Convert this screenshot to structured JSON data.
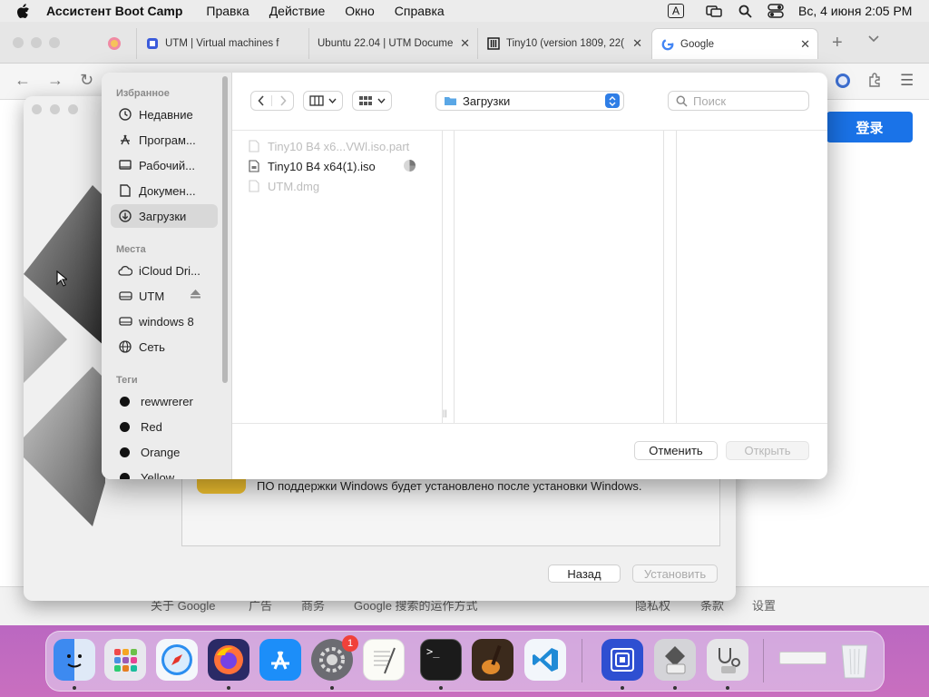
{
  "menubar": {
    "app_name": "Ассистент Boot Camp",
    "items": [
      "Правка",
      "Действие",
      "Окно",
      "Справка"
    ],
    "datetime": "Вс, 4 июня  2:05 PM",
    "input_indicator": "A"
  },
  "browser": {
    "tabs": [
      {
        "label": "UTM | Virtual machines f"
      },
      {
        "label": "Ubuntu 22.04 | UTM Docume"
      },
      {
        "label": "Tiny10 (version 1809, 22("
      },
      {
        "label": "Google"
      }
    ],
    "login_button": "登录",
    "footer_left": [
      "关于 Google",
      "广告",
      "商务",
      "Google 搜索的运作方式"
    ],
    "footer_right": [
      "隐私权",
      "条款",
      "设置"
    ]
  },
  "bootcamp": {
    "message": "ПО поддержки Windows будет установлено после установки Windows.",
    "back_button": "Назад",
    "install_button": "Установить"
  },
  "dialog": {
    "favorites_header": "Избранное",
    "favorites": [
      {
        "label": "Недавние",
        "icon": "clock-icon"
      },
      {
        "label": "Програм...",
        "icon": "applications-icon"
      },
      {
        "label": "Рабочий...",
        "icon": "desktop-icon"
      },
      {
        "label": "Докумен...",
        "icon": "document-icon"
      },
      {
        "label": "Загрузки",
        "icon": "download-icon"
      }
    ],
    "places_header": "Места",
    "places": [
      {
        "label": "iCloud Dri...",
        "icon": "cloud-icon"
      },
      {
        "label": "UTM",
        "icon": "disk-icon"
      },
      {
        "label": "windows 8",
        "icon": "disk-icon"
      },
      {
        "label": "Сеть",
        "icon": "network-icon"
      }
    ],
    "tags_header": "Теги",
    "tags": [
      "rewwrerer",
      "Red",
      "Orange",
      "Yellow"
    ],
    "location": "Загрузки",
    "search_placeholder": "Поиск",
    "files": [
      {
        "name": "Tiny10 B4 x6...VWl.iso.part",
        "enabled": false
      },
      {
        "name": "Tiny10 B4 x64(1).iso",
        "enabled": true
      },
      {
        "name": "UTM.dmg",
        "enabled": false
      }
    ],
    "cancel_button": "Отменить",
    "open_button": "Открыть"
  },
  "dock": {
    "apps": [
      "finder",
      "launchpad",
      "safari",
      "firefox",
      "app-store",
      "system-preferences",
      "textedit",
      "terminal",
      "garageband",
      "vscode",
      "utm",
      "boot-camp-assistant",
      "disk-utility",
      "downloads-stack",
      "trash"
    ],
    "settings_badge": "1"
  },
  "colors": {
    "accent": "#1a73e8",
    "dialog_accent": "#5aa7e6"
  }
}
